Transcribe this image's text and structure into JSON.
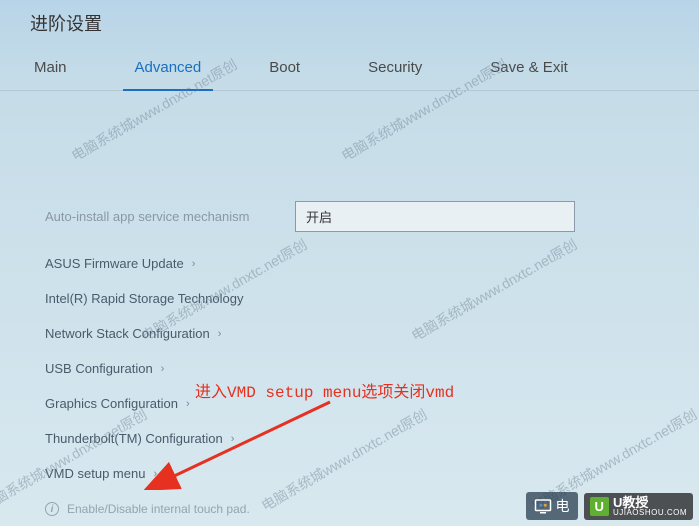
{
  "header": {
    "title": "进阶设置"
  },
  "tabs": [
    {
      "label": "Main",
      "active": false
    },
    {
      "label": "Advanced",
      "active": true
    },
    {
      "label": "Boot",
      "active": false
    },
    {
      "label": "Security",
      "active": false
    },
    {
      "label": "Save & Exit",
      "active": false
    }
  ],
  "setting": {
    "label": "Auto-install app service mechanism",
    "value": "开启"
  },
  "menu_items": [
    "ASUS Firmware Update",
    "Intel(R) Rapid Storage Technology",
    "Network Stack Configuration",
    "USB Configuration",
    "Graphics Configuration",
    "Thunderbolt(TM) Configuration",
    "VMD setup menu"
  ],
  "footer_help": "Enable/Disable internal touch pad.",
  "annotation": "进入VMD setup menu选项关闭vmd",
  "watermark_text": "电脑系统城www.dnxtc.net原创",
  "logos": {
    "logo1_text": "电",
    "logo2_badge": "U",
    "logo2_main": "U教授",
    "logo2_sub": "UJIAOSHOU.COM"
  }
}
